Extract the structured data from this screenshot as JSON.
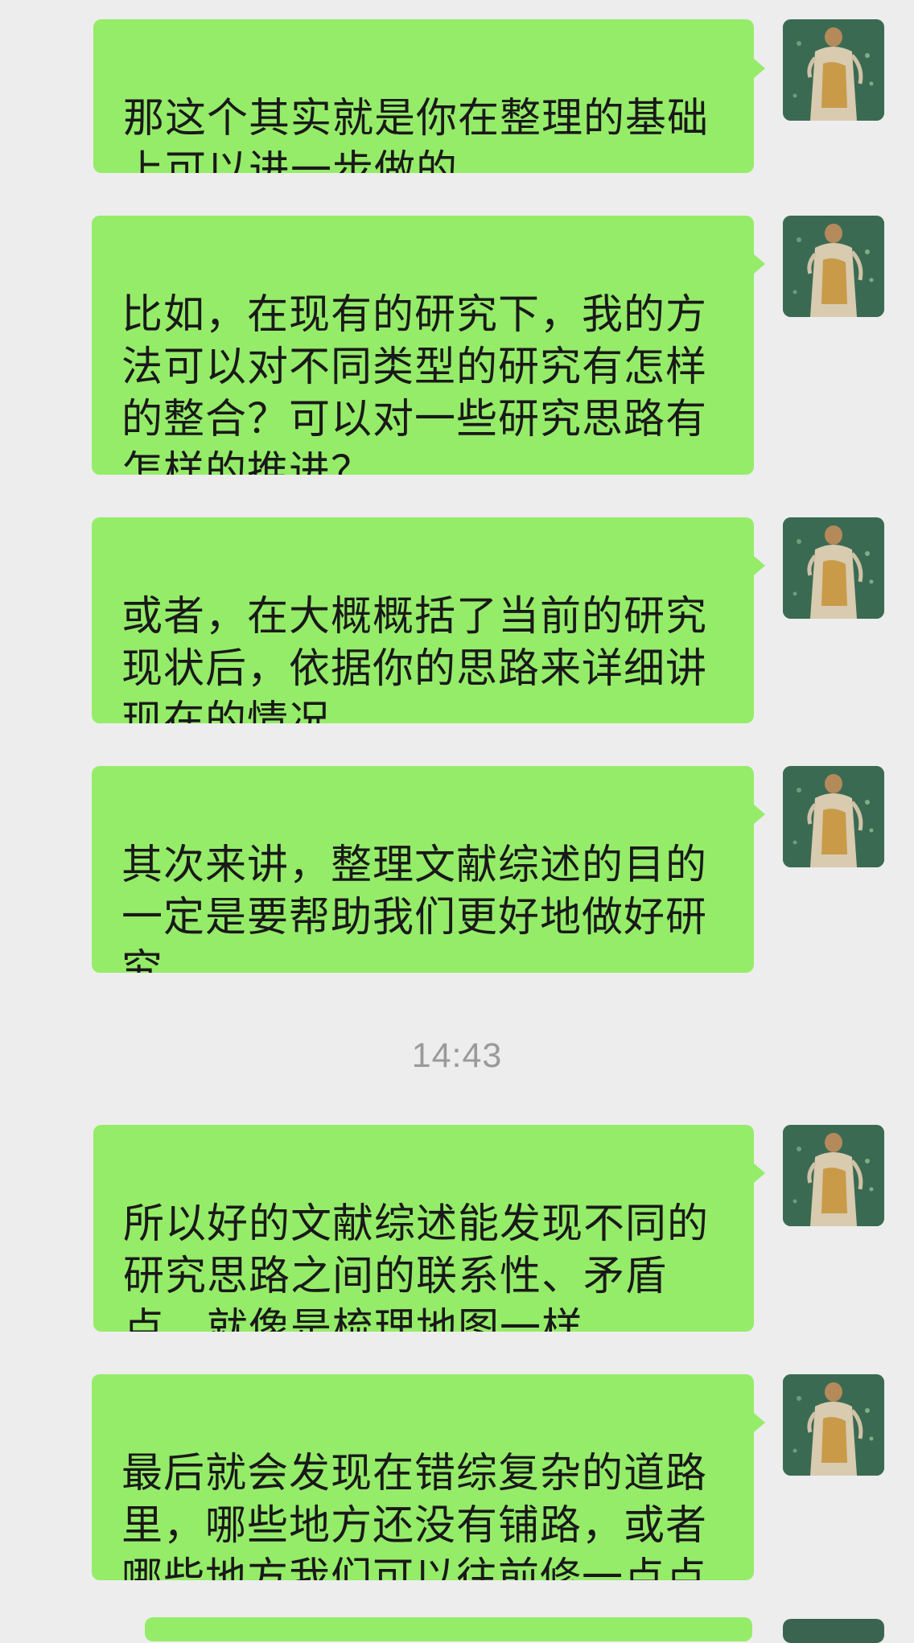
{
  "messages": [
    {
      "text": "那这个其实就是你在整理的基础\n上可以进一步做的"
    },
    {
      "text": "比如，在现有的研究下，我的方\n法可以对不同类型的研究有怎样\n的整合？可以对一些研究思路有\n怎样的推进？"
    },
    {
      "text": "或者，在大概概括了当前的研究\n现状后，依据你的思路来详细讲\n现在的情况"
    },
    {
      "text": "其次来讲，整理文献综述的目的\n一定是要帮助我们更好地做好研\n究"
    },
    {
      "text": "所以好的文献综述能发现不同的\n研究思路之间的联系性、矛盾\n点，就像是梳理地图一样"
    },
    {
      "text": "最后就会发现在错综复杂的道路\n里，哪些地方还没有铺路，或者\n哪些地方我们可以往前修一点点"
    }
  ],
  "timestamp": "14:43",
  "colors": {
    "background": "#ededed",
    "bubble": "#95ec69",
    "text": "#191919",
    "timestamp": "#9a9a9a"
  }
}
